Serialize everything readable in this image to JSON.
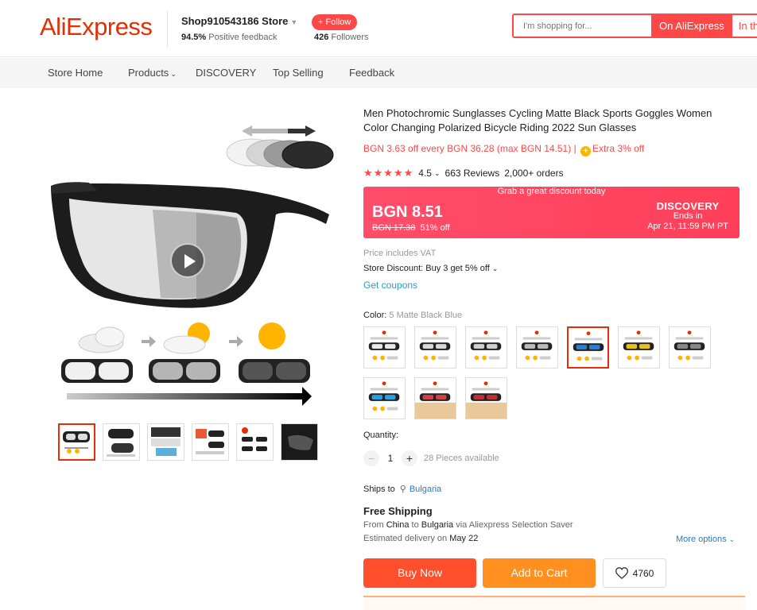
{
  "header": {
    "logo": "AliExpress",
    "store_name": "Shop910543186 Store",
    "feedback_percent": "94.5%",
    "feedback_label": "Positive feedback",
    "follow_label": "+ Follow",
    "followers_count": "426",
    "followers_label": "Followers",
    "search_placeholder": "I'm shopping for...",
    "search_on": "On AliExpress",
    "search_in": "In th"
  },
  "nav": {
    "items": [
      "Store Home",
      "Products",
      "DISCOVERY",
      "Top Selling",
      "Feedback"
    ]
  },
  "product": {
    "title": "Men Photochromic Sunglasses Cycling Matte Black Sports Goggles Women Color Changing Polarized Bicycle Riding 2022 Sun Glasses",
    "promo": "BGN 3.63 off every BGN 36.28 (max BGN 14.51)",
    "promo_sep": "|",
    "extra": "Extra 3% off",
    "rating": "4.5",
    "reviews": "663 Reviews",
    "orders": "2,000+ orders",
    "stars_value": 4.5,
    "deal": {
      "banner": "Grab a great discount today",
      "price": "BGN 8.51",
      "old_price": "BGN 17.38",
      "discount": "51% off",
      "brand": "DISCOVERY",
      "ends_label": "Ends in",
      "ends_date": "Apr 21, 11:59 PM PT"
    },
    "vat": "Price includes VAT",
    "store_discount": "Store Discount: Buy 3 get 5% off",
    "coupons": "Get coupons",
    "color_label": "Color:",
    "color_value": "5 Matte Black Blue",
    "swatch_count": 10,
    "active_swatch": 4,
    "quantity_label": "Quantity:",
    "quantity": "1",
    "available": "28 Pieces available",
    "ships_to_label": "Ships to",
    "ships_to_country": "Bulgaria",
    "free_shipping": "Free Shipping",
    "ship_from_prefix": "From",
    "ship_from": "China",
    "ship_to_prefix": "to",
    "ship_to": "Bulgaria",
    "ship_via": "via Aliexpress Selection Saver",
    "est_prefix": "Estimated delivery on",
    "est_date": "May 22",
    "more_options": "More options",
    "buy_now": "Buy Now",
    "add_to_cart": "Add to Cart",
    "wishlist_count": "4760"
  },
  "colors": {
    "brand": "#e62e04",
    "accent": "#ff4747",
    "buy": "#ff4f2d",
    "cart": "#ff8f1f",
    "link": "#2e79c3"
  }
}
